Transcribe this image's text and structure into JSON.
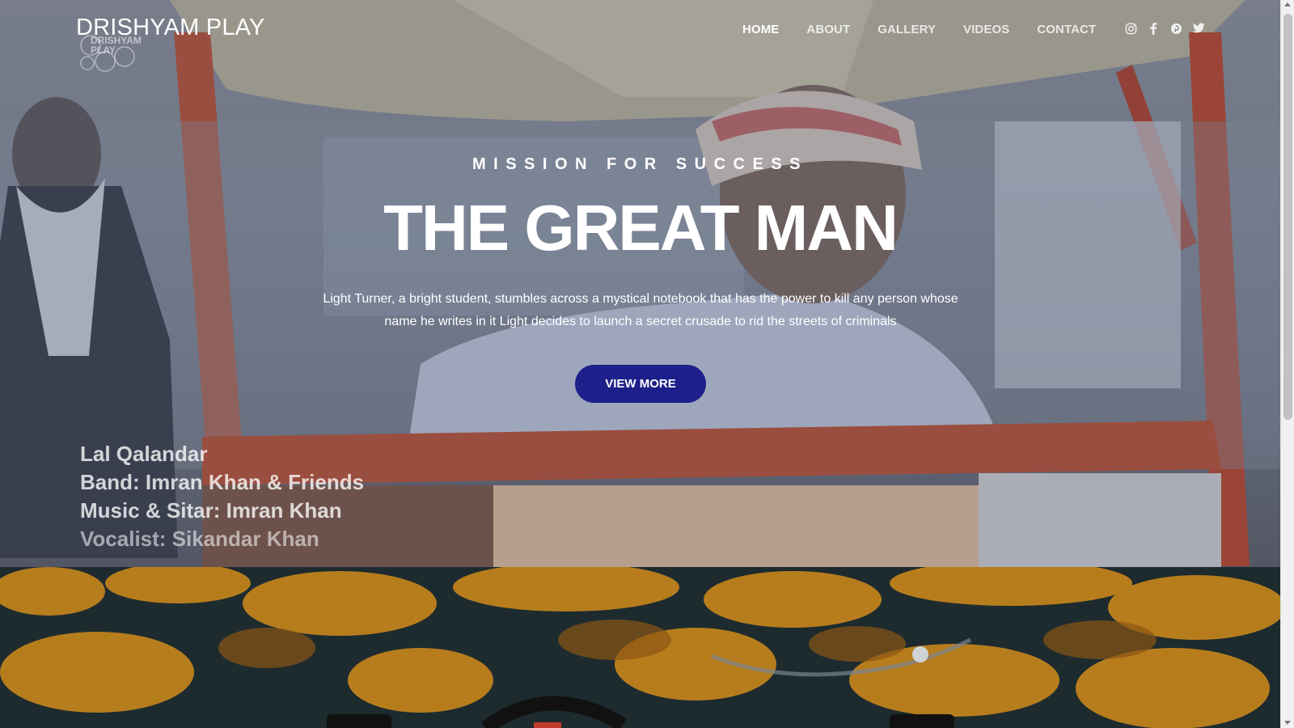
{
  "brand": {
    "name": "DRISHYAM PLAY",
    "mark_text": "DRISHYAM\nPLAY"
  },
  "nav": {
    "items": [
      {
        "label": "HOME",
        "active": true
      },
      {
        "label": "ABOUT",
        "active": false
      },
      {
        "label": "GALLERY",
        "active": false
      },
      {
        "label": "VIDEOS",
        "active": false
      },
      {
        "label": "CONTACT",
        "active": false
      }
    ]
  },
  "social": [
    "instagram-icon",
    "facebook-icon",
    "pinterest-icon",
    "twitter-icon"
  ],
  "hero": {
    "tagline": "MISSION FOR SUCCESS",
    "title": "THE GREAT MAN",
    "description": "Light Turner, a bright student, stumbles across a mystical notebook that has the power to kill any person whose name he writes in it Light decides to launch a secret crusade to rid the streets of criminals",
    "cta_label": "VIEW MORE",
    "credits": [
      "Lal Qalandar",
      "Band: Imran Khan & Friends",
      "Music & Sitar: Imran Khan",
      "Vocalist: Sikandar Khan"
    ]
  },
  "colors": {
    "cta": "#1d1f8a",
    "forest_foliage": "#c8861c",
    "forest_bg": "#1b2a2e"
  }
}
